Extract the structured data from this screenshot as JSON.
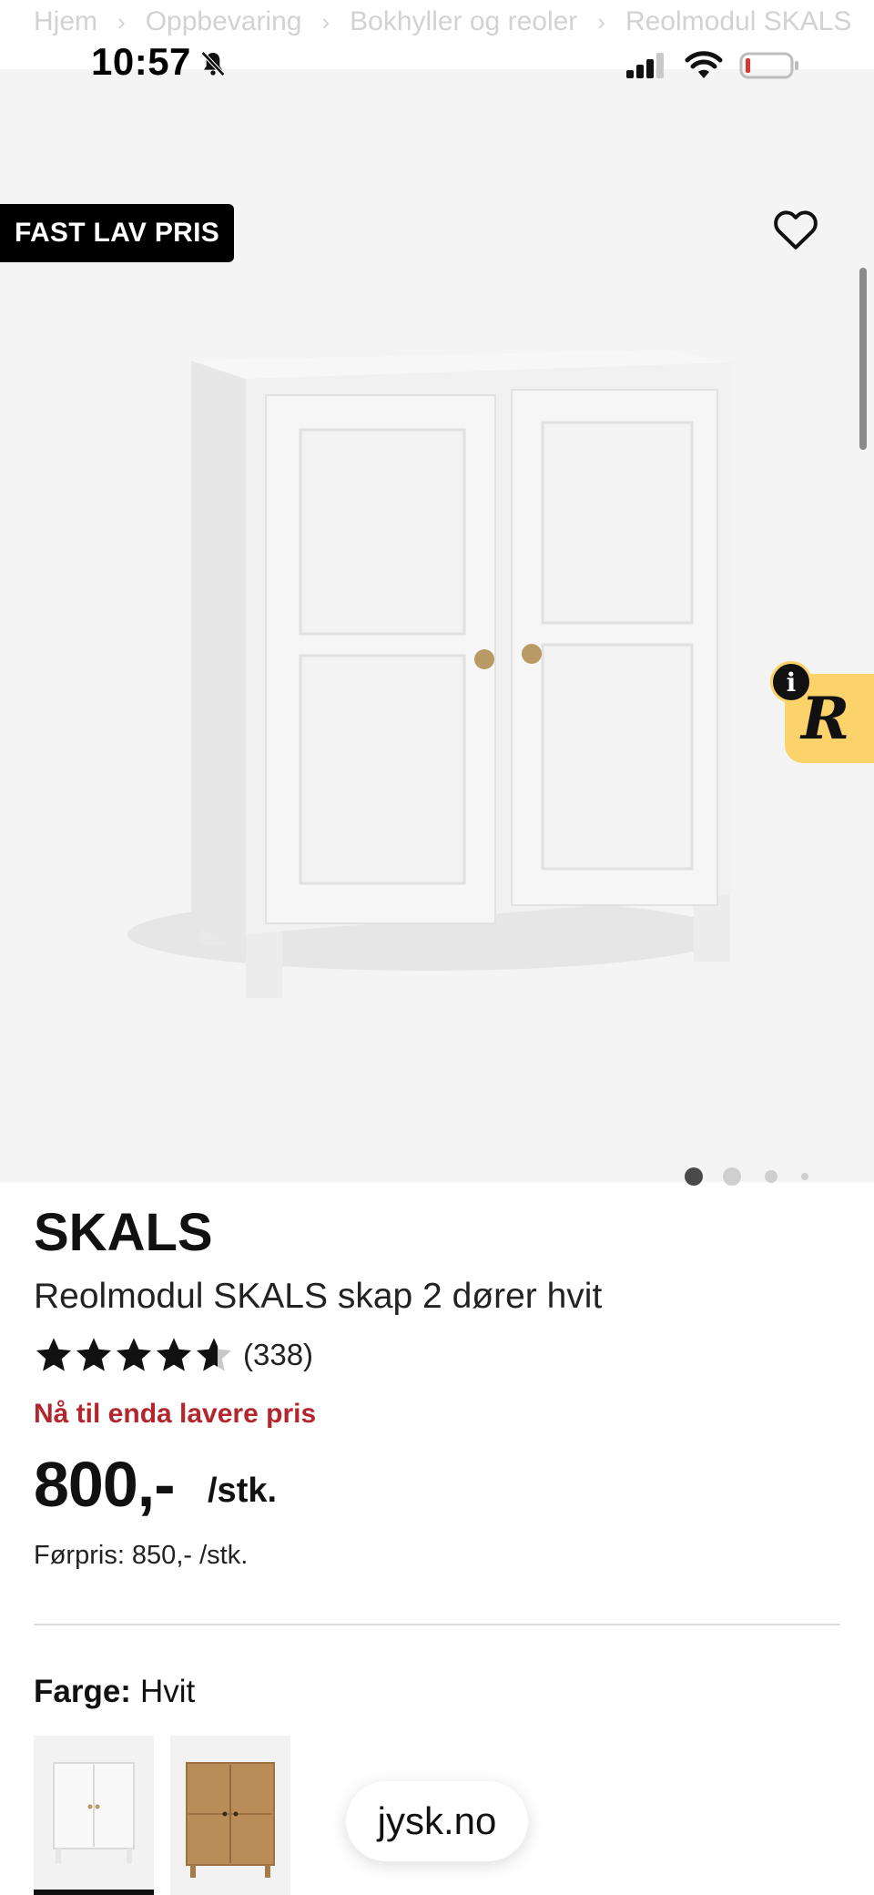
{
  "breadcrumb": [
    "Hjem",
    "Oppbevaring",
    "Bokhyller og reoler",
    "Reolmodul SKALS"
  ],
  "status_bar": {
    "time": "10:57"
  },
  "hero": {
    "badge": "FAST LAV PRIS",
    "rewards_logo": "R",
    "info_glyph": "i",
    "carousel": {
      "total": 4,
      "active_index": 0
    }
  },
  "product": {
    "brand": "SKALS",
    "name": "Reolmodul SKALS skap 2 dører hvit",
    "rating": 4.6,
    "review_count": "(338)",
    "promo_text": "Nå til enda lavere pris",
    "price": "800,-",
    "unit": "/stk.",
    "prior_price": "Førpris: 850,- /stk."
  },
  "color": {
    "label": "Farge:",
    "value": "Hvit",
    "options": [
      "Hvit",
      "Eik"
    ],
    "selected_index": 0
  },
  "browser": {
    "url": "jysk.no"
  },
  "colors": {
    "promo_red": "#b3262e",
    "rewards_yellow": "#fcd36a",
    "badge_bg": "#000000"
  }
}
